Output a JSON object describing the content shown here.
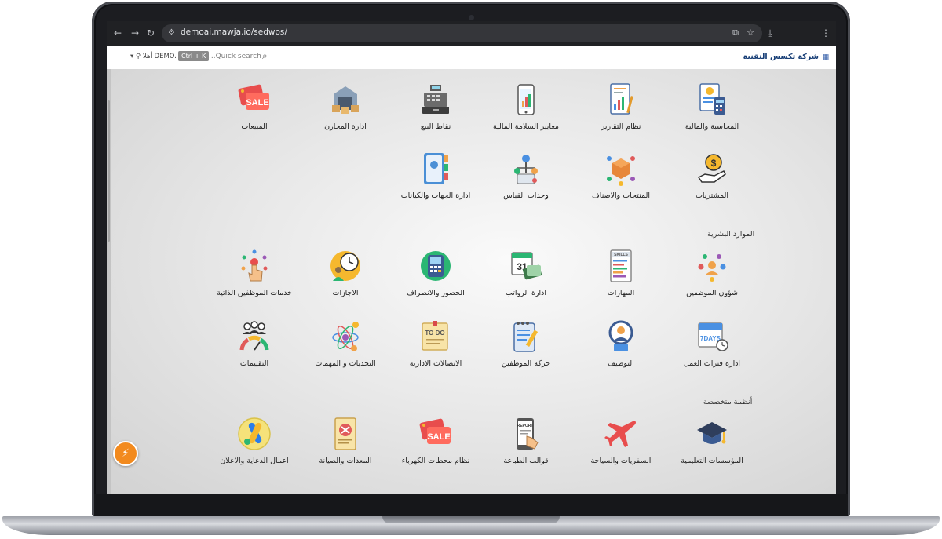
{
  "browser": {
    "url": "demoai.mawja.io/sedwos/",
    "back": "←",
    "forward": "→",
    "reload": "↻"
  },
  "header": {
    "company": "شركة تكسس التقنية",
    "search_placeholder": "...Quick search",
    "shortcut": "Ctrl + K",
    "user": "أهلا DEMO."
  },
  "sections": {
    "hr": "الموارد البشرية",
    "specialized": "أنظمة متخصصة"
  },
  "modules": {
    "row1": [
      "المحاسبة والمالية",
      "نظام التقارير",
      "معايير السلامة المالية",
      "نقاط البيع",
      "ادارة المخازن",
      "المبيعات"
    ],
    "row2": [
      "المشتريات",
      "المنتجات والاصناف",
      "وحدات القياس",
      "ادارة الجهات والكيانات"
    ],
    "row3": [
      "شؤون الموظفين",
      "المهارات",
      "ادارة الرواتب",
      "الحضور والانصراف",
      "الاجازات",
      "خدمات الموظفين الذاتية"
    ],
    "row4": [
      "ادارة فترات العمل",
      "التوظيف",
      "حركة الموظفين",
      "الاتصالات الادارية",
      "التحديات و المهمات",
      "التقييمات"
    ],
    "row5": [
      "المؤسسات التعليمية",
      "السفريات والسياحة",
      "قوالب الطباعة",
      "نظام محطات الكهرباء",
      "المعدات والصيانة",
      "اعمال الدعاية والاعلان"
    ]
  },
  "icon_texts": {
    "sale": "SALE",
    "report": "REPORT",
    "todo": "TO DO",
    "days": "7DAYS",
    "cal": "31",
    "skills": "SKILLS"
  },
  "colors": {
    "brand": "#173e76",
    "fab": "#f28a1e"
  }
}
